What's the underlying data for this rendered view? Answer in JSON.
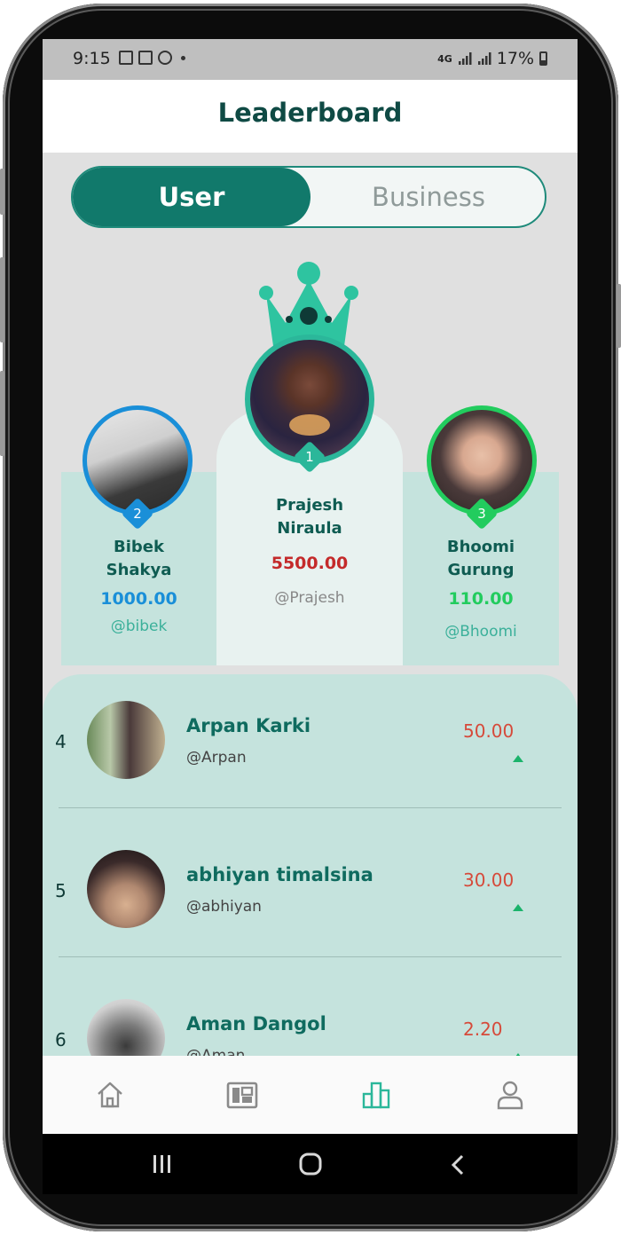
{
  "status_bar": {
    "time": "9:15",
    "network": "4G",
    "battery": "17%"
  },
  "header": {
    "title": "Leaderboard"
  },
  "toggle": {
    "active": "User",
    "inactive": "Business"
  },
  "podium": [
    {
      "rank": "2",
      "name_line1": "Bibek",
      "name_line2": "Shakya",
      "score": "1000.00",
      "handle": "@bibek",
      "accent": "#1a8fd8"
    },
    {
      "rank": "1",
      "name_line1": "Prajesh",
      "name_line2": "Niraula",
      "score": "5500.00",
      "handle": "@Prajesh",
      "accent": "#2bb79a"
    },
    {
      "rank": "3",
      "name_line1": "Bhoomi",
      "name_line2": "Gurung",
      "score": "110.00",
      "handle": "@Bhoomi",
      "accent": "#22cc5e"
    }
  ],
  "list": [
    {
      "rank": "4",
      "name": "Arpan Karki",
      "handle": "@Arpan",
      "score": "50.00",
      "trend": "up"
    },
    {
      "rank": "5",
      "name": "abhiyan timalsina",
      "handle": "@abhiyan",
      "score": "30.00",
      "trend": "up"
    },
    {
      "rank": "6",
      "name": "Aman Dangol",
      "handle": "@Aman",
      "score": "2.20",
      "trend": "up"
    }
  ],
  "bottom_nav": [
    {
      "icon": "home-icon",
      "active": false
    },
    {
      "icon": "gallery-icon",
      "active": false
    },
    {
      "icon": "leaderboard-icon",
      "active": true
    },
    {
      "icon": "profile-icon",
      "active": false
    }
  ],
  "colors": {
    "primary": "#11796b",
    "podium_bg": "#c5e3dd",
    "score_red": "#d64a3a",
    "trend_green": "#1bb36b"
  }
}
